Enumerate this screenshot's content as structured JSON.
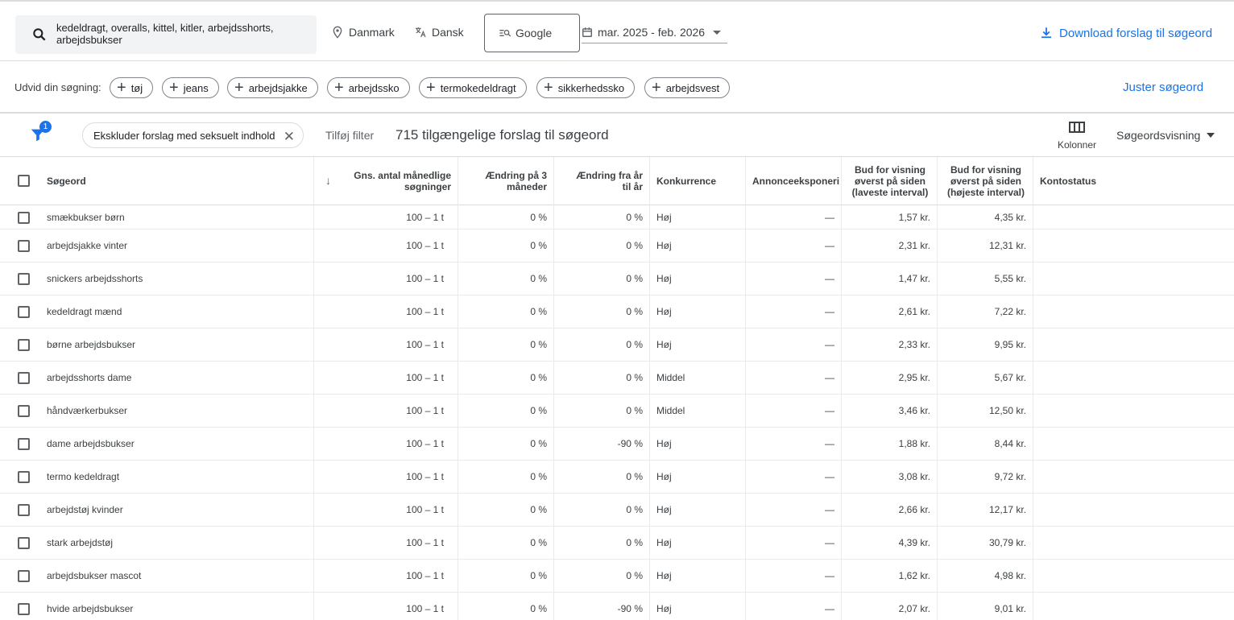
{
  "search": {
    "query": "kedeldragt, overalls, kittel, kitler, arbejdsshorts, arbejdsbukser"
  },
  "options": {
    "location": "Danmark",
    "language": "Dansk",
    "engine": "Google",
    "date_range": "mar. 2025 - feb. 2026"
  },
  "download_label": "Download forslag til søgeord",
  "expand": {
    "label": "Udvid din søgning:",
    "chips": [
      "tøj",
      "jeans",
      "arbejdsjakke",
      "arbejdssko",
      "termokedeldragt",
      "sikkerhedssko",
      "arbejdsvest"
    ],
    "adjust_label": "Juster søgeord"
  },
  "filterbar": {
    "badge": "1",
    "active_filter": "Ekskluder forslag med seksuelt indhold",
    "add_filter": "Tilføj filter",
    "count_text": "715 tilgængelige forslag til søgeord",
    "columns_label": "Kolonner",
    "view_label": "Søgeordsvisning"
  },
  "table": {
    "headers": {
      "keyword": "Søgeord",
      "avg_searches": "Gns. antal månedlige søgninger",
      "change_3m": "Ændring på 3 måneder",
      "change_yoy": "Ændring fra år til år",
      "competition": "Konkurrence",
      "ad_impr": "Annonceeksponeri",
      "bid_low": "Bud for visning øverst på siden (laveste interval)",
      "bid_high": "Bud for visning øverst på siden (højeste interval)",
      "account_status": "Kontostatus"
    },
    "rows": [
      {
        "keyword": "smækbukser børn",
        "searches": "100 – 1 t",
        "c3": "0 %",
        "cy": "0 %",
        "comp": "Høj",
        "impr": "—",
        "low": "1,57 kr.",
        "high": "4,35 kr."
      },
      {
        "keyword": "arbejdsjakke vinter",
        "searches": "100 – 1 t",
        "c3": "0 %",
        "cy": "0 %",
        "comp": "Høj",
        "impr": "—",
        "low": "2,31 kr.",
        "high": "12,31 kr."
      },
      {
        "keyword": "snickers arbejdsshorts",
        "searches": "100 – 1 t",
        "c3": "0 %",
        "cy": "0 %",
        "comp": "Høj",
        "impr": "—",
        "low": "1,47 kr.",
        "high": "5,55 kr."
      },
      {
        "keyword": "kedeldragt mænd",
        "searches": "100 – 1 t",
        "c3": "0 %",
        "cy": "0 %",
        "comp": "Høj",
        "impr": "—",
        "low": "2,61 kr.",
        "high": "7,22 kr."
      },
      {
        "keyword": "børne arbejdsbukser",
        "searches": "100 – 1 t",
        "c3": "0 %",
        "cy": "0 %",
        "comp": "Høj",
        "impr": "—",
        "low": "2,33 kr.",
        "high": "9,95 kr."
      },
      {
        "keyword": "arbejdsshorts dame",
        "searches": "100 – 1 t",
        "c3": "0 %",
        "cy": "0 %",
        "comp": "Middel",
        "impr": "—",
        "low": "2,95 kr.",
        "high": "5,67 kr."
      },
      {
        "keyword": "håndværkerbukser",
        "searches": "100 – 1 t",
        "c3": "0 %",
        "cy": "0 %",
        "comp": "Middel",
        "impr": "—",
        "low": "3,46 kr.",
        "high": "12,50 kr."
      },
      {
        "keyword": "dame arbejdsbukser",
        "searches": "100 – 1 t",
        "c3": "0 %",
        "cy": "-90 %",
        "comp": "Høj",
        "impr": "—",
        "low": "1,88 kr.",
        "high": "8,44 kr."
      },
      {
        "keyword": "termo kedeldragt",
        "searches": "100 – 1 t",
        "c3": "0 %",
        "cy": "0 %",
        "comp": "Høj",
        "impr": "—",
        "low": "3,08 kr.",
        "high": "9,72 kr."
      },
      {
        "keyword": "arbejdstøj kvinder",
        "searches": "100 – 1 t",
        "c3": "0 %",
        "cy": "0 %",
        "comp": "Høj",
        "impr": "—",
        "low": "2,66 kr.",
        "high": "12,17 kr."
      },
      {
        "keyword": "stark arbejdstøj",
        "searches": "100 – 1 t",
        "c3": "0 %",
        "cy": "0 %",
        "comp": "Høj",
        "impr": "—",
        "low": "4,39 kr.",
        "high": "30,79 kr."
      },
      {
        "keyword": "arbejdsbukser mascot",
        "searches": "100 – 1 t",
        "c3": "0 %",
        "cy": "0 %",
        "comp": "Høj",
        "impr": "—",
        "low": "1,62 kr.",
        "high": "4,98 kr."
      },
      {
        "keyword": "hvide arbejdsbukser",
        "searches": "100 – 1 t",
        "c3": "0 %",
        "cy": "-90 %",
        "comp": "Høj",
        "impr": "—",
        "low": "2,07 kr.",
        "high": "9,01 kr."
      }
    ]
  }
}
